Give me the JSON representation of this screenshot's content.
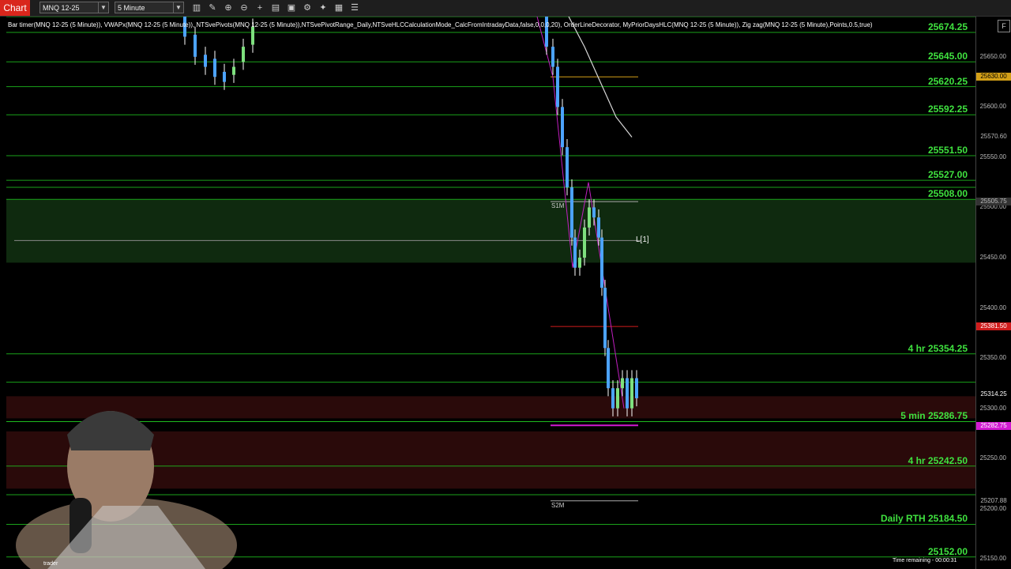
{
  "toolbar": {
    "chart_tab": "Chart",
    "instrument": "MNQ 12-25",
    "interval": "5 Minute",
    "icons": [
      "bar-type-icon",
      "draw-icon",
      "zoom-in-icon",
      "zoom-out-icon",
      "crosshair-icon",
      "data-box-icon",
      "instrument-icon",
      "properties-icon",
      "strategy-icon",
      "template-icon",
      "menu-icon"
    ]
  },
  "indicators_text": "Bar timer(MNQ 12-25 (5 Minute)), VWAPx(MNQ 12-25 (5 Minute)), NTSvePivots(MNQ 12-25 (5 Minute)),NTSvePivotRange_Daily,NTSveHLCCalculationMode_CalcFromIntradayData,false,0,0,0,20), OrderLineDecorator, MyPriorDaysHLC(MNQ 12-25 (5 Minute)), Zig zag(MNQ 12-25 (5 Minute),Points,0.5,true)",
  "price_range": {
    "min": 25140,
    "max": 25690
  },
  "level_labels": [
    {
      "text": "25674.25",
      "price": 25674.25
    },
    {
      "text": "25645.00",
      "price": 25645.0
    },
    {
      "text": "25620.25",
      "price": 25620.25
    },
    {
      "text": "25592.25",
      "price": 25592.25
    },
    {
      "text": "25551.50",
      "price": 25551.5
    },
    {
      "text": "25527.00",
      "price": 25527.0
    },
    {
      "text": "25508.00",
      "price": 25508.0
    },
    {
      "text": "4 hr 25354.25",
      "price": 25354.25
    },
    {
      "text": "5 min  25286.75",
      "price": 25286.75
    },
    {
      "text": "4 hr 25242.50",
      "price": 25242.5
    },
    {
      "text": "Daily RTH 25184.50",
      "price": 25184.5
    },
    {
      "text": "25152.00",
      "price": 25152.0
    }
  ],
  "axis_ticks": [
    "25650.00",
    "25600.00",
    "25550.00",
    "25500.00",
    "25450.00",
    "25400.00",
    "25350.00",
    "25300.00",
    "25250.00",
    "25200.00",
    "25150.00"
  ],
  "axis_flags": [
    {
      "text": "25630.00",
      "price": 25630.0,
      "bg": "#d4a017",
      "fg": "#000000"
    },
    {
      "text": "25570.60",
      "price": 25570.6,
      "bg": "#000000",
      "fg": "#bbbbbb"
    },
    {
      "text": "25505.75",
      "price": 25505.75,
      "bg": "#333333",
      "fg": "#bbbbbb"
    },
    {
      "text": "25381.50",
      "price": 25381.5,
      "bg": "#d01c1c",
      "fg": "#ffffff"
    },
    {
      "text": "25314.25",
      "price": 25314.25,
      "bg": "#000000",
      "fg": "#ffffff"
    },
    {
      "text": "25282.75",
      "price": 25282.75,
      "bg": "#d21ad2",
      "fg": "#ffffff"
    },
    {
      "text": "25207.88",
      "price": 25207.88,
      "bg": "#000000",
      "fg": "#bbbbbb"
    }
  ],
  "pivot_labels": {
    "s1m": "S1M",
    "s2m": "S2M",
    "l1": "L[1]"
  },
  "time_remaining": "Time remaining - 00:00:31",
  "webcam_label": "trader",
  "colors": {
    "level_line": "#1fbf1f",
    "bull": "#7ee07e",
    "bear": "#4ca3ff",
    "zone_green": "#0f2a0f",
    "zone_red": "#2a0a0a",
    "vwap": "#d8d8d8"
  }
}
